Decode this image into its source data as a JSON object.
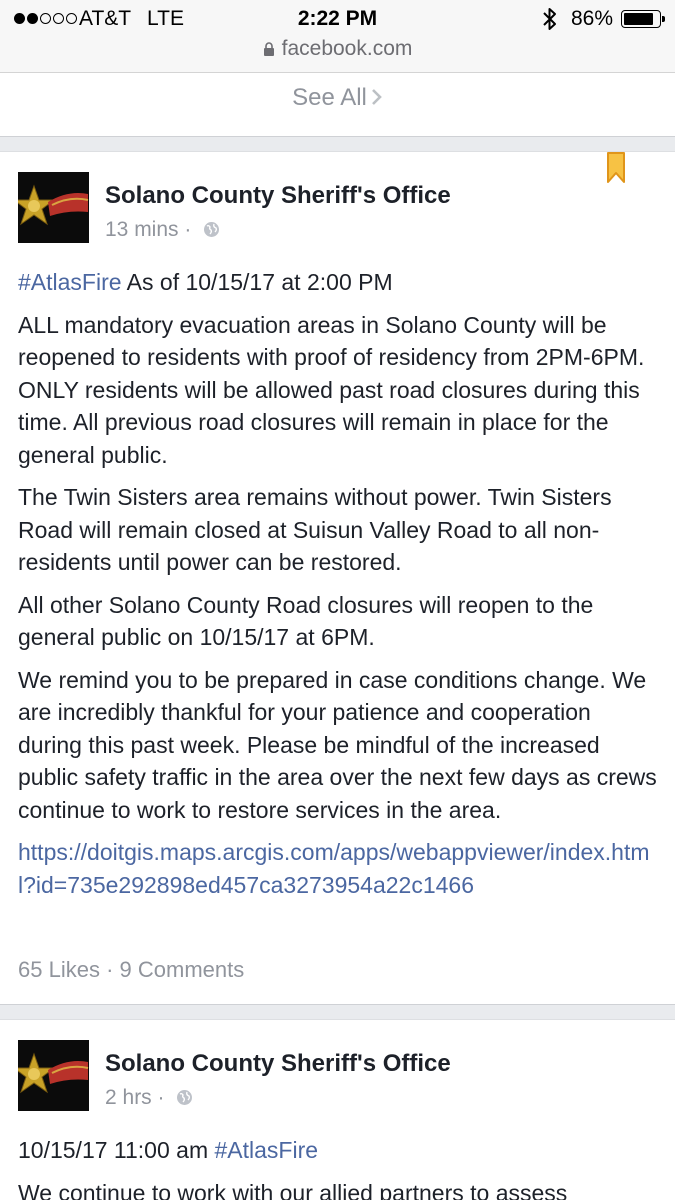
{
  "status_bar": {
    "carrier": "AT&T",
    "network": "LTE",
    "time": "2:22 PM",
    "battery_percent": "86%",
    "battery_level": 0.86,
    "signal_bars_filled": 2,
    "signal_bars_total": 5
  },
  "browser": {
    "url": "facebook.com"
  },
  "see_all": {
    "label": "See All"
  },
  "posts": [
    {
      "author": "Solano County Sheriff's Office",
      "time": "13 mins",
      "separator": "·",
      "hashtag": "#AtlasFire",
      "headline": "As of 10/15/17 at 2:00 PM",
      "paragraphs": [
        "ALL mandatory evacuation areas in Solano County will be reopened to residents with proof of residency from 2PM-6PM. ONLY residents will be allowed past road closures during this time. All previous road closures will remain in place for the general public.",
        "The Twin Sisters area remains without power. Twin Sisters Road will remain closed at Suisun Valley Road to all non-residents until power can be restored.",
        "All other Solano County Road closures will reopen to the general public on 10/15/17 at 6PM.",
        "We remind you to be prepared in case conditions change. We are incredibly thankful for your patience and cooperation during this past week. Please be mindful of the increased public safety traffic in the area over the next few days as crews continue to work to restore services in the area."
      ],
      "link": "https://doitgis.maps.arcgis.com/apps/webappviewer/index.html?id=735e292898ed457ca3273954a22c1466",
      "likes": "65 Likes",
      "comments": "9 Comments",
      "stats_separator": "·"
    },
    {
      "author": "Solano County Sheriff's Office",
      "time": "2 hrs",
      "separator": "·",
      "headline": "10/15/17 11:00 am",
      "hashtag": "#AtlasFire",
      "paragraph_partial": "We continue to work with our allied partners to assess"
    }
  ],
  "colors": {
    "link": "#4b67a1",
    "muted": "#90949c",
    "bookmark": "#f5a623",
    "divider": "#e9ebee"
  }
}
